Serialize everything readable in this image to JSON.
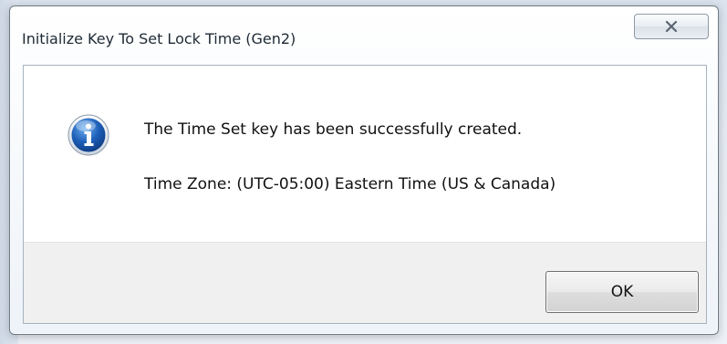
{
  "dialog": {
    "title": "Initialize Key To Set Lock Time (Gen2)",
    "close_icon": "close-icon",
    "info_icon": "information-icon",
    "message": "The Time Set key has been successfully created.",
    "time_zone_text": "Time Zone: (UTC-05:00) Eastern Time (US & Canada)",
    "ok_label": "OK"
  },
  "colors": {
    "info_icon_blue": "#1d5fb8",
    "footer_background": "#f0f0f0",
    "border": "#6e7a87"
  }
}
